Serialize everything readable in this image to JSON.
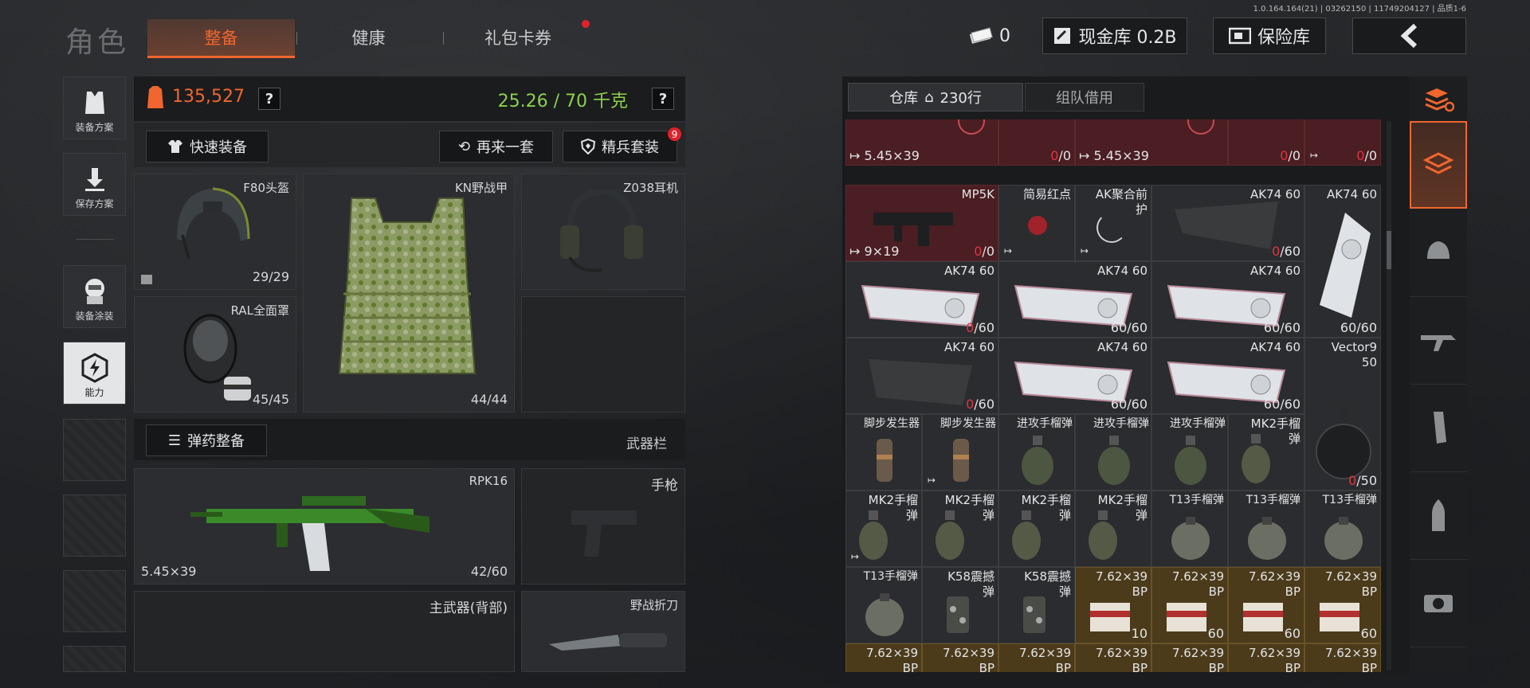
{
  "version": "1.0.164.164(21) | 03262150 | 11749204127 | 品质1-6",
  "header": {
    "title": "角色",
    "tabs": [
      {
        "label": "整备",
        "active": true
      },
      {
        "label": "健康",
        "active": false
      },
      {
        "label": "礼包卡券",
        "active": false,
        "badge_dot": true
      }
    ],
    "currency_count": "0",
    "cash_vault": "现金库 0.2B",
    "insurance_vault": "保险库"
  },
  "left_menu": [
    {
      "label": "装备方案",
      "icon": "vest-icon"
    },
    {
      "label": "保存方案",
      "icon": "download-icon"
    },
    {
      "label": "装备涂装",
      "icon": "mask-icon"
    },
    {
      "label": "能力",
      "icon": "lightning-hexagon-icon",
      "active": true
    }
  ],
  "equipment": {
    "value": "135,527",
    "weight": "25.26 / 70 千克",
    "quick_equip": "快速装备",
    "again": "再来一套",
    "elite": "精兵套装",
    "elite_badge": "9",
    "helmet": {
      "name": "F80头盔",
      "count": "29/29"
    },
    "armor": {
      "name": "KN野战甲",
      "count": "44/44"
    },
    "headset": {
      "name": "Z038耳机"
    },
    "mask": {
      "name": "RAL全面罩",
      "count": "45/45"
    },
    "ammo_prep": "弹药整备",
    "weapon_bar": "武器栏",
    "primary": {
      "name": "RPK16",
      "caliber": "5.45×39",
      "count": "42/60"
    },
    "pistol": "手枪",
    "secondary": "主武器(背部)",
    "knife": "野战折刀"
  },
  "warehouse": {
    "tab_label": "仓库",
    "rows": "230行",
    "borrow": "组队借用"
  },
  "colors": {
    "accent": "#f0662e",
    "green_weight": "#8bd14b",
    "red_zero": "#e0363e"
  }
}
